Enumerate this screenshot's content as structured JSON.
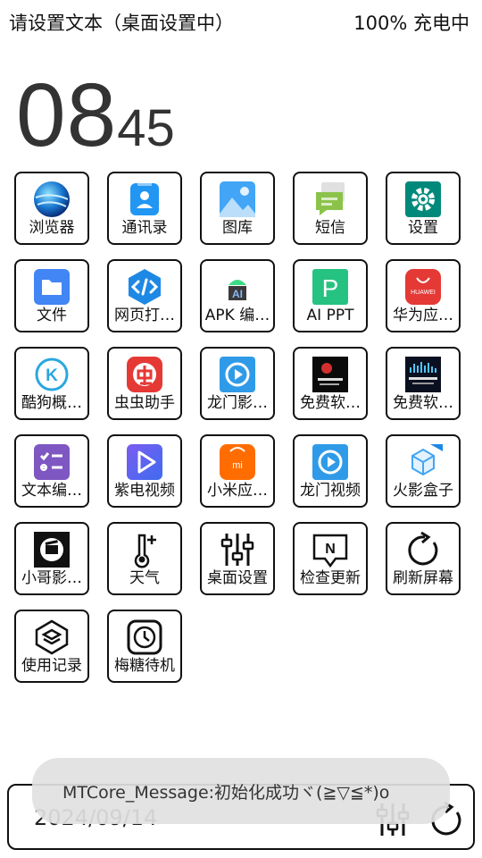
{
  "status": {
    "left_text": "请设置文本（桌面设置中）",
    "right_text": "100% 充电中"
  },
  "clock": {
    "hours": "08",
    "minutes": "45"
  },
  "apps": [
    {
      "label": "浏览器",
      "icon": "browser-globe-icon"
    },
    {
      "label": "通讯录",
      "icon": "contacts-icon"
    },
    {
      "label": "图库",
      "icon": "gallery-icon"
    },
    {
      "label": "短信",
      "icon": "messages-icon"
    },
    {
      "label": "设置",
      "icon": "settings-gear-icon"
    },
    {
      "label": "文件",
      "icon": "folder-icon"
    },
    {
      "label": "网页打…",
      "icon": "code-icon"
    },
    {
      "label": "APK 编…",
      "icon": "android-icon"
    },
    {
      "label": "AI PPT",
      "icon": "ppt-p-icon"
    },
    {
      "label": "华为应…",
      "icon": "huawei-appgallery-icon"
    },
    {
      "label": "酷狗概…",
      "icon": "kugou-k-icon"
    },
    {
      "label": "虫虫助手",
      "icon": "chongchong-icon"
    },
    {
      "label": "龙门影…",
      "icon": "longmen-play-icon"
    },
    {
      "label": "免费软…",
      "icon": "free-software-icon"
    },
    {
      "label": "免费软…",
      "icon": "free-software-2-icon"
    },
    {
      "label": "文本编…",
      "icon": "text-editor-icon"
    },
    {
      "label": "紫电视频",
      "icon": "zidian-play-icon"
    },
    {
      "label": "小米应…",
      "icon": "xiaomi-store-icon"
    },
    {
      "label": "龙门视频",
      "icon": "longmen-video-icon"
    },
    {
      "label": "火影盒子",
      "icon": "huoying-box-icon"
    },
    {
      "label": "小哥影…",
      "icon": "xiaoge-film-icon"
    },
    {
      "label": "天气",
      "icon": "thermometer-icon"
    },
    {
      "label": "桌面设置",
      "icon": "sliders-icon"
    },
    {
      "label": "检查更新",
      "icon": "update-n-icon"
    },
    {
      "label": "刷新屏幕",
      "icon": "refresh-icon"
    },
    {
      "label": "使用记录",
      "icon": "layers-hexagon-icon"
    },
    {
      "label": "梅糖待机",
      "icon": "clock-icon"
    }
  ],
  "bottom": {
    "date": "2024/09/14",
    "left_icon": "sliders-icon",
    "right_icon": "refresh-icon"
  },
  "toast": {
    "message": "MTCore_Message:初始化成功ヾ(≧▽≦*)o"
  }
}
